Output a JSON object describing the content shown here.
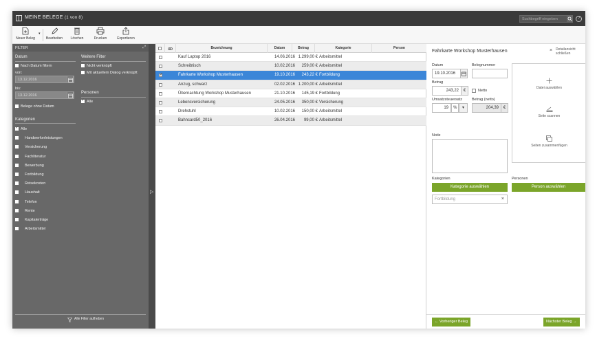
{
  "titlebar": {
    "title": "MEINE BELEGE",
    "count": "(1 von 8)",
    "search_placeholder": "Suchbegriff eingeben",
    "help": "?"
  },
  "toolbar": {
    "new": "Neuer Beleg",
    "edit": "Bearbeiten",
    "delete": "Löschen",
    "print": "Drucken",
    "export": "Exportieren"
  },
  "filter": {
    "header": "FILTER",
    "date_section": "Datum",
    "filter_by_date": "Nach Datum filtern",
    "from_label": "von:",
    "from_value": "13.12.2016",
    "to_label": "bis:",
    "to_value": "13.12.2016",
    "without_date": "Belege ohne Datum",
    "more_section": "Weitere Filter",
    "not_linked": "Nicht verknüpft",
    "linked_current": "Mit aktuellem Dialog verknüpft",
    "persons_section": "Personen",
    "persons_all": "Alle",
    "categories_section": "Kategorien",
    "categories": [
      "Alle",
      "Handwerkerleistungen",
      "Versicherung",
      "Fachliteratur",
      "Bewerbung",
      "Fortbildung",
      "Reisekosten",
      "Haushalt",
      "Telefon",
      "Rente",
      "Kapitalerträge",
      "Arbeitsmittel"
    ],
    "reset": "Alle Filter aufheben"
  },
  "table": {
    "headers": {
      "name": "Bezeichnung",
      "date": "Datum",
      "amount": "Betrag",
      "category": "Kategorie",
      "person": "Person"
    },
    "rows": [
      {
        "name": "Kauf Laptop 2016",
        "date": "14.06.2016",
        "amount": "1.299,00 €",
        "category": "Arbeitsmittel"
      },
      {
        "name": "Schreibtisch",
        "date": "10.02.2016",
        "amount": "259,00 €",
        "category": "Arbeitsmittel"
      },
      {
        "name": "Fahrkarte Workshop Musterhausen",
        "date": "19.10.2016",
        "amount": "243,22 €",
        "category": "Fortbildung"
      },
      {
        "name": "Anzug, schwarz",
        "date": "02.02.2016",
        "amount": "1.200,00 €",
        "category": "Arbeitsmittel"
      },
      {
        "name": "Übernachtung Workshop Musterhausen",
        "date": "21.10.2016",
        "amount": "145,19 €",
        "category": "Fortbildung"
      },
      {
        "name": "Lebensversicherung",
        "date": "24.05.2016",
        "amount": "350,00 €",
        "category": "Versicherung"
      },
      {
        "name": "Drehstuhl",
        "date": "10.02.2016",
        "amount": "150,00 €",
        "category": "Arbeitsmittel"
      },
      {
        "name": "Bahncard50_2016",
        "date": "26.04.2016",
        "amount": "99,00 €",
        "category": "Arbeitsmittel"
      }
    ]
  },
  "detail": {
    "title": "Fahrkarte Workshop Musterhausen",
    "close": "Detailansicht schließen",
    "date_label": "Datum",
    "date_value": "19.10.2016",
    "receipt_no_label": "Belegnummer",
    "receipt_no_value": "",
    "amount_label": "Betrag",
    "amount_value": "243,22",
    "currency": "€",
    "net_label": "Netto",
    "vat_label": "Umsatzsteuersatz",
    "vat_value": "19",
    "percent": "%",
    "net_amount_label": "Betrag (netto)",
    "net_amount_value": "204,39",
    "select_file": "Datei auswählen",
    "scan_page": "Seite scannen",
    "merge_pages": "Seiten zusammenfügen",
    "note_label": "Notiz",
    "categories_label": "Kategorien",
    "category_button": "Kategorie auswählen",
    "category_value": "Fortbildung",
    "persons_label": "Personen",
    "person_button": "Person auswählen",
    "prev": "Vorheriger Beleg",
    "next": "Nächster Beleg"
  }
}
